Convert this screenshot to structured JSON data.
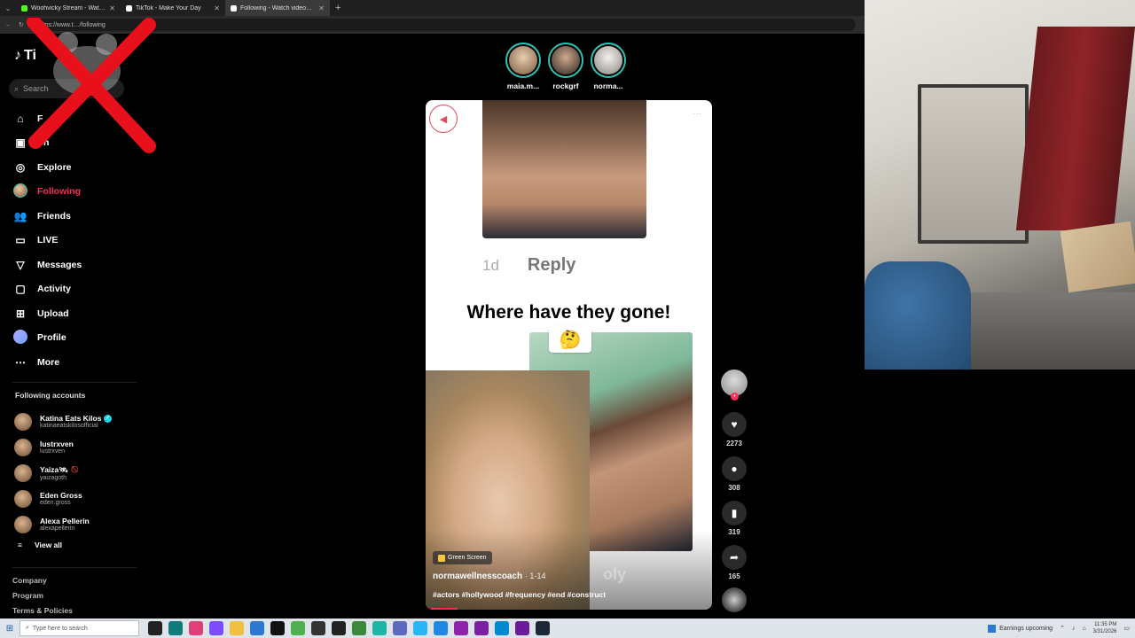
{
  "browser": {
    "tabs": [
      {
        "title": "Woohvicky Stream - Watch Live o",
        "color": "#53fc18",
        "active": false
      },
      {
        "title": "TikTok - Make Your Day",
        "color": "#ffffff",
        "active": false
      },
      {
        "title": "Following - Watch videos from cre",
        "color": "#ffffff",
        "active": true
      }
    ],
    "new_tab": "+",
    "url": "https://www.t…/following"
  },
  "sidebar": {
    "logo": "Ti",
    "search_placeholder": "Search",
    "nav": [
      {
        "label": "F",
        "icon": "home-icon",
        "glyph": "⌂",
        "active": false
      },
      {
        "label": "Sh",
        "icon": "shop-icon",
        "glyph": "▣",
        "active": false
      },
      {
        "label": "Explore",
        "icon": "compass-icon",
        "glyph": "◎",
        "active": false
      },
      {
        "label": "Following",
        "icon": "following-avatar-icon",
        "glyph": "",
        "active": true
      },
      {
        "label": "Friends",
        "icon": "friends-icon",
        "glyph": "👥",
        "active": false
      },
      {
        "label": "LIVE",
        "icon": "live-icon",
        "glyph": "▭",
        "active": false
      },
      {
        "label": "Messages",
        "icon": "messages-icon",
        "glyph": "▽",
        "active": false
      },
      {
        "label": "Activity",
        "icon": "activity-icon",
        "glyph": "▢",
        "active": false
      },
      {
        "label": "Upload",
        "icon": "upload-icon",
        "glyph": "⊞",
        "active": false
      },
      {
        "label": "Profile",
        "icon": "profile-avatar-icon",
        "glyph": "",
        "active": false
      },
      {
        "label": "More",
        "icon": "more-icon",
        "glyph": "⋯",
        "active": false
      }
    ],
    "following_title": "Following accounts",
    "following": [
      {
        "name": "Katina Eats Kilos",
        "handle": "katinaeatskilosofficial",
        "badge": "verified"
      },
      {
        "name": "lustrxven",
        "handle": "lustrxven",
        "badge": ""
      },
      {
        "name": "Yaiza🛰",
        "handle": "yaizagoth",
        "badge": "🚫"
      },
      {
        "name": "Eden Gross",
        "handle": "eden.gross",
        "badge": ""
      },
      {
        "name": "Alexa Pellerin",
        "handle": "alexapellerin",
        "badge": ""
      }
    ],
    "view_all": "View all",
    "footer": [
      "Company",
      "Program",
      "Terms & Policies"
    ]
  },
  "stories": [
    {
      "name": "maia.m...",
      "color": "#c9a27e"
    },
    {
      "name": "rockgrf",
      "color": "#3a302c"
    },
    {
      "name": "norma...",
      "color": "#e8e4e0"
    }
  ],
  "video": {
    "comment_time": "1d",
    "comment_reply": "Reply",
    "headline": "Where have they gone!",
    "emoji": "🤔",
    "green_screen": "Green Screen",
    "author": "normawellnesscoach",
    "date": "· 1-14",
    "tags": "#actors #hollywood #frequency #end #construct",
    "watermark": "oly"
  },
  "actions": {
    "likes": "2273",
    "comments": "308",
    "saves": "319",
    "shares": "165"
  },
  "taskbar": {
    "search_placeholder": "Type here to search",
    "earnings": "Earnings upcoming",
    "time": "11:35 PM",
    "date": "3/31/2026"
  },
  "colors": {
    "accent": "#fe2c55",
    "story_ring": "#2ec4b6",
    "verified": "#20d5ec"
  }
}
